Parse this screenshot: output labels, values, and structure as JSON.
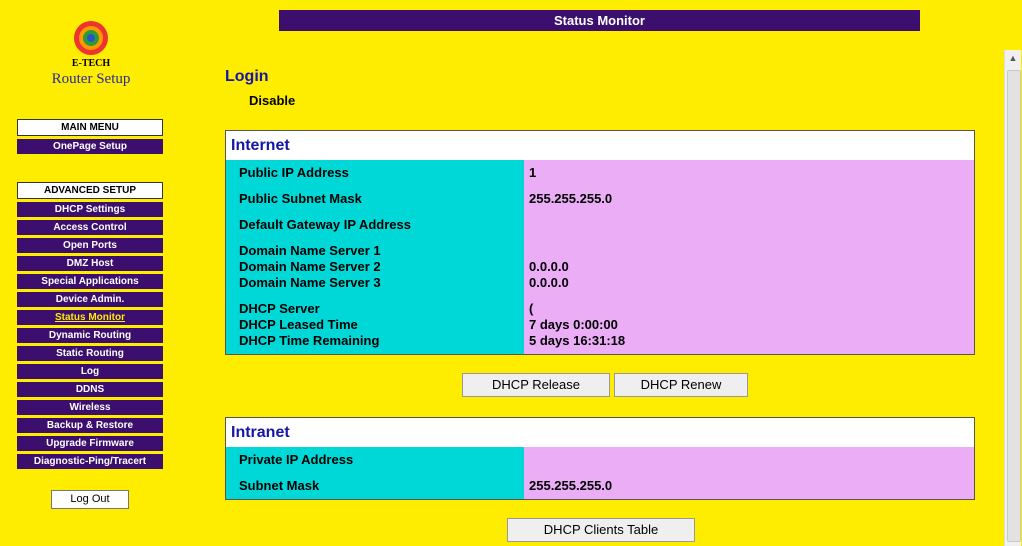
{
  "logo": {
    "brand": "E-TECH",
    "subtitle": "Router Setup"
  },
  "sidebar": {
    "main_menu": "MAIN MENU",
    "main_items": [
      "OnePage Setup"
    ],
    "advanced_setup": "ADVANCED SETUP",
    "advanced_items": [
      "DHCP Settings",
      "Access Control",
      "Open Ports",
      "DMZ Host",
      "Special Applications",
      "Device Admin.",
      "Status Monitor",
      "Dynamic Routing",
      "Static Routing",
      "Log",
      "DDNS",
      "Wireless",
      "Backup & Restore",
      "Upgrade Firmware",
      "Diagnostic-Ping/Tracert"
    ],
    "active_item": "Status Monitor",
    "logout": "Log Out"
  },
  "header": {
    "title": "Status Monitor"
  },
  "login": {
    "label": "Login",
    "value": "Disable"
  },
  "internet": {
    "title": "Internet",
    "rows": [
      {
        "label": "Public IP Address",
        "value": "1"
      },
      {
        "label": "Public Subnet Mask",
        "value": "255.255.255.0"
      },
      {
        "label": "Default Gateway IP Address",
        "value": ""
      },
      {
        "label": "Domain Name Server 1",
        "value": ""
      },
      {
        "label": "Domain Name Server 2",
        "value": "0.0.0.0"
      },
      {
        "label": "Domain Name Server 3",
        "value": "0.0.0.0"
      },
      {
        "label": "DHCP Server",
        "value": "("
      },
      {
        "label": "DHCP Leased Time",
        "value": "7 days 0:00:00"
      },
      {
        "label": "DHCP Time Remaining",
        "value": "5 days 16:31:18"
      }
    ],
    "buttons": {
      "release": "DHCP Release",
      "renew": "DHCP Renew"
    }
  },
  "intranet": {
    "title": "Intranet",
    "rows": [
      {
        "label": "Private IP Address",
        "value": ""
      },
      {
        "label": "Subnet Mask",
        "value": "255.255.255.0"
      }
    ],
    "buttons": {
      "clients": "DHCP Clients Table"
    }
  },
  "colors": {
    "background": "#ffed00",
    "menu": "#3c0f6e",
    "label_col": "#00d8d8",
    "value_col": "#eaadf6",
    "heading": "#1515a6"
  }
}
